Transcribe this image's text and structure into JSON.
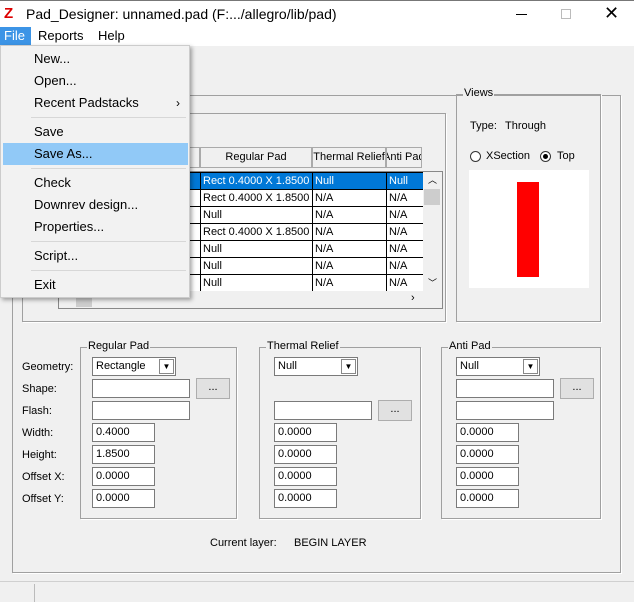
{
  "window": {
    "title": "Pad_Designer: unnamed.pad (F:.../allegro/lib/pad)",
    "icon": "pad-designer-logo-icon",
    "controls": [
      "minimize",
      "maximize",
      "close"
    ]
  },
  "menubar": {
    "items": [
      "File",
      "Reports",
      "Help"
    ],
    "active": "File"
  },
  "file_menu": {
    "items": [
      {
        "label": "New..."
      },
      {
        "label": "Open..."
      },
      {
        "label": "Recent Padstacks",
        "submenu": true
      },
      {
        "label": "Save"
      },
      {
        "label": "Save As...",
        "highlighted": true
      },
      {
        "label": "Check"
      },
      {
        "label": "Downrev design..."
      },
      {
        "label": "Properties..."
      },
      {
        "label": "Script..."
      },
      {
        "label": "Exit"
      }
    ]
  },
  "layers_table": {
    "columns": [
      "",
      "Regular Pad",
      "Thermal Relief",
      "Anti Pad"
    ],
    "rows": [
      [
        "Rect 0.4000 X 1.8500",
        "Null",
        "Null"
      ],
      [
        "Rect 0.4000 X 1.8500",
        "N/A",
        "N/A"
      ],
      [
        "Null",
        "N/A",
        "N/A"
      ],
      [
        "Rect 0.4000 X 1.8500",
        "N/A",
        "N/A"
      ],
      [
        "Null",
        "N/A",
        "N/A"
      ],
      [
        "Null",
        "N/A",
        "N/A"
      ],
      [
        "Null",
        "N/A",
        "N/A"
      ]
    ],
    "selected_row": 0
  },
  "views": {
    "title": "Views",
    "type_label": "Type:",
    "type_value": "Through",
    "radio_xsection": "XSection",
    "radio_top": "Top",
    "selected": "Top",
    "pad_color": "#ff0000"
  },
  "regular_pad": {
    "title": "Regular Pad",
    "geometry": "Rectangle",
    "shape": "",
    "flash": "",
    "width": "0.4000",
    "height": "1.8500",
    "offset_x": "0.0000",
    "offset_y": "0.0000"
  },
  "thermal_relief": {
    "title": "Thermal Relief",
    "geometry": "Null",
    "flash": "",
    "width": "0.0000",
    "height": "0.0000",
    "offset_x": "0.0000",
    "offset_y": "0.0000"
  },
  "anti_pad": {
    "title": "Anti Pad",
    "geometry": "Null",
    "shape": "",
    "flash": "",
    "width": "0.0000",
    "height": "0.0000",
    "offset_x": "0.0000",
    "offset_y": "0.0000"
  },
  "labels": {
    "geometry": "Geometry:",
    "shape": "Shape:",
    "flash": "Flash:",
    "width": "Width:",
    "height": "Height:",
    "offset_x": "Offset X:",
    "offset_y": "Offset Y:",
    "browse": "..."
  },
  "current_layer": {
    "label": "Current layer:",
    "value": "BEGIN LAYER"
  }
}
